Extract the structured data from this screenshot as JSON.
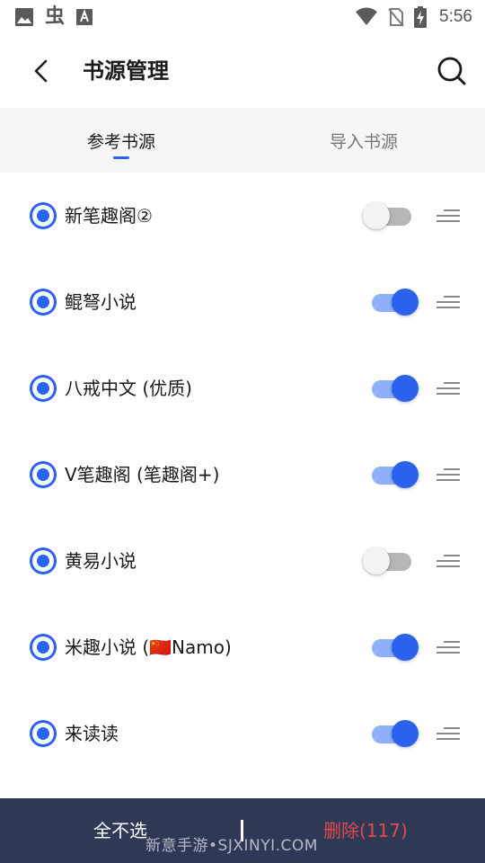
{
  "status_bar": {
    "time": "5:56",
    "left_icons": [
      "image-icon",
      "bug-icon",
      "font-a-icon"
    ],
    "right_icons": [
      "wifi-icon",
      "no-sim-icon",
      "battery-charging-icon"
    ]
  },
  "header": {
    "title": "书源管理"
  },
  "tabs": [
    {
      "label": "参考书源",
      "active": true
    },
    {
      "label": "导入书源",
      "active": false
    }
  ],
  "sources": [
    {
      "name": "新笔趣阁②",
      "selected": true,
      "enabled": false
    },
    {
      "name": "鲲弩小说",
      "selected": true,
      "enabled": true
    },
    {
      "name": "八戒中文 (优质)",
      "selected": true,
      "enabled": true
    },
    {
      "name": "V笔趣阁 (笔趣阁+)",
      "selected": true,
      "enabled": true
    },
    {
      "name": "黄易小说",
      "selected": true,
      "enabled": false
    },
    {
      "name": "米趣小说 (🇨🇳Namo)",
      "selected": true,
      "enabled": true
    },
    {
      "name": "来读读",
      "selected": true,
      "enabled": true
    }
  ],
  "bottom_bar": {
    "select_none_label": "全不选",
    "delete_label": "删除(117)",
    "watermark": "新意手游•SJXINYI.COM"
  },
  "colors": {
    "accent": "#2a63f0",
    "bottom_bar": "#2e3a55",
    "delete": "#e5484d"
  }
}
